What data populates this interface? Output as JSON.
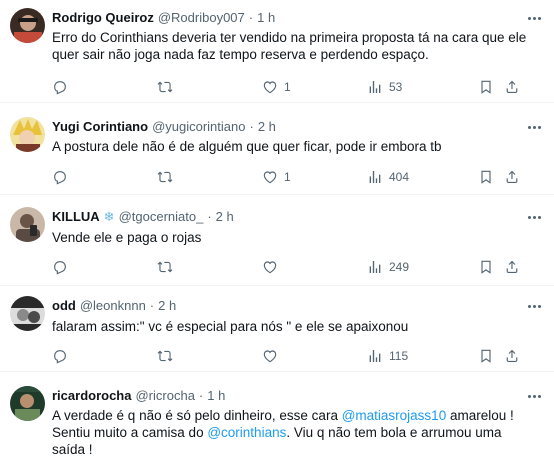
{
  "tweets": [
    {
      "name": "Rodrigo Queiroz",
      "handle": "@Rodriboy007",
      "separator": "·",
      "time": "1 h",
      "text": "Erro do Corinthians deveria ter vendido na primeira proposta tá na cara que ele quer sair não joga nada faz tempo reserva e perdendo espaço.",
      "likes": "1",
      "views": "53",
      "retweets": "",
      "replies": "",
      "avatar_colors": [
        "#3a2a24",
        "#c44a3a"
      ]
    },
    {
      "name": "Yugi Corintiano",
      "handle": "@yugicorintiano",
      "separator": "·",
      "time": "2 h",
      "text": "A postura dele não é de alguém que quer ficar, pode ir embora tb",
      "likes": "1",
      "views": "404",
      "retweets": "",
      "replies": "",
      "avatar_colors": [
        "#e8c23a",
        "#7a3a2a"
      ]
    },
    {
      "name": "KILLUA",
      "name_emoji": "❄",
      "handle": "@tgocerniato_",
      "separator": "·",
      "time": "2 h",
      "text": "Vende ele e paga o rojas",
      "likes": "",
      "views": "249",
      "retweets": "",
      "replies": "",
      "avatar_colors": [
        "#c9b8a8",
        "#5a4a44"
      ]
    },
    {
      "name": "odd",
      "handle": "@leonknnn",
      "separator": "·",
      "time": "2 h",
      "text": "falaram assim:\" vc é especial para nós \" e ele se apaixonou",
      "likes": "",
      "views": "115",
      "retweets": "",
      "replies": "",
      "avatar_colors": [
        "#2a2a2a",
        "#dcdcdc"
      ]
    },
    {
      "name": "ricardorocha",
      "handle": "@ricrocha",
      "separator": "·",
      "time": "1 h",
      "text_parts": [
        "A verdade é q não é só pelo dinheiro, esse cara ",
        "@matiasrojass10",
        " amarelou ! Sentiu muito a camisa do ",
        "@corinthians",
        ". Viu q não tem bola e arrumou uma saída !"
      ],
      "avatar_colors": [
        "#1e3a2a",
        "#6a8a5a"
      ]
    }
  ],
  "icons": {
    "reply": "reply-icon",
    "retweet": "retweet-icon",
    "like": "heart-icon",
    "views": "views-icon",
    "bookmark": "bookmark-icon",
    "share": "share-icon",
    "more": "more-icon"
  }
}
